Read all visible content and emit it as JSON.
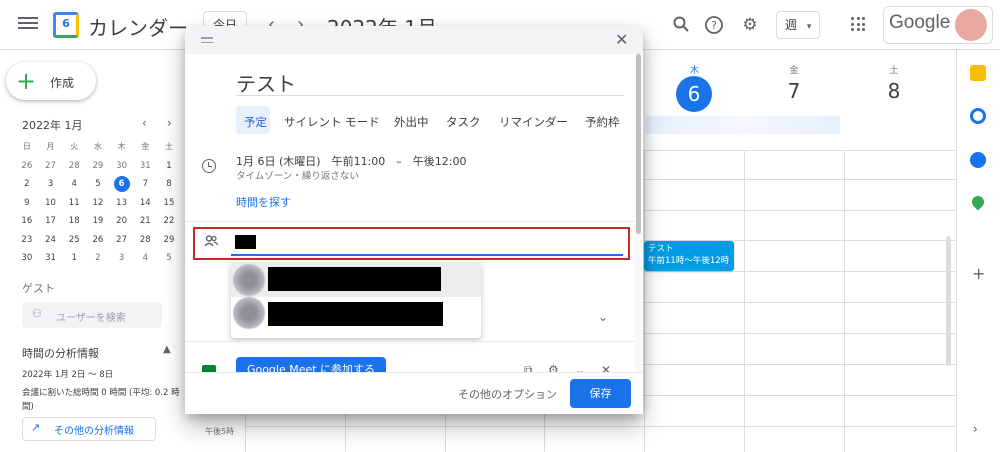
{
  "header": {
    "app_title": "カレンダー",
    "logo_number": "6",
    "today_button": "今日",
    "prev_arrow": "‹",
    "next_arrow": "›",
    "current_period": "2022年 1月",
    "view_selector": "週",
    "view_chevron": "▾",
    "google_label": "Google"
  },
  "sidebar": {
    "create_label": "作成",
    "mini_calendar": {
      "title": "2022年 1月",
      "weekdays": [
        "日",
        "月",
        "火",
        "水",
        "木",
        "金",
        "土"
      ],
      "days": [
        "26",
        "27",
        "28",
        "29",
        "30",
        "31",
        "1",
        "2",
        "3",
        "4",
        "5",
        "6",
        "7",
        "8",
        "9",
        "10",
        "11",
        "12",
        "13",
        "14",
        "15",
        "16",
        "17",
        "18",
        "19",
        "20",
        "21",
        "22",
        "23",
        "24",
        "25",
        "26",
        "27",
        "28",
        "29",
        "30",
        "31",
        "1",
        "2",
        "3",
        "4",
        "5"
      ],
      "selected_day": "6"
    },
    "guest_section_title": "ゲスト",
    "guest_search_placeholder": "ユーザーを検索",
    "analytics": {
      "title": "時間の分析情報",
      "range": "2022年 1月 2日 〜 8日",
      "description": "会議に割いた総時間 0 時間 (平均: 0.2 時間)",
      "button": "その他の分析情報"
    }
  },
  "week": {
    "days": [
      {
        "dow": "木",
        "num": "6",
        "today": true
      },
      {
        "dow": "金",
        "num": "7",
        "today": false
      },
      {
        "dow": "土",
        "num": "8",
        "today": false
      }
    ],
    "time_label": "午後5時"
  },
  "event": {
    "title": "テスト",
    "time": "午前11時～午後12時"
  },
  "dialog": {
    "title": "テスト",
    "tabs": [
      "予定",
      "サイレント モード",
      "外出中",
      "タスク",
      "リマインダー",
      "予約枠"
    ],
    "datetime": "1月 6日 (木曜日)　午前11:00　–　午後12:00",
    "datetime_sub": "タイムゾーン・繰り返さない",
    "find_time": "時間を探す",
    "meet_button": "Google Meet に参加する",
    "more_options": "その他のオプション",
    "save": "保存"
  },
  "colors": {
    "accent": "#1a73e8",
    "event": "#039be5",
    "highlight_border": "#c62828",
    "create_plus": "#34a853"
  }
}
